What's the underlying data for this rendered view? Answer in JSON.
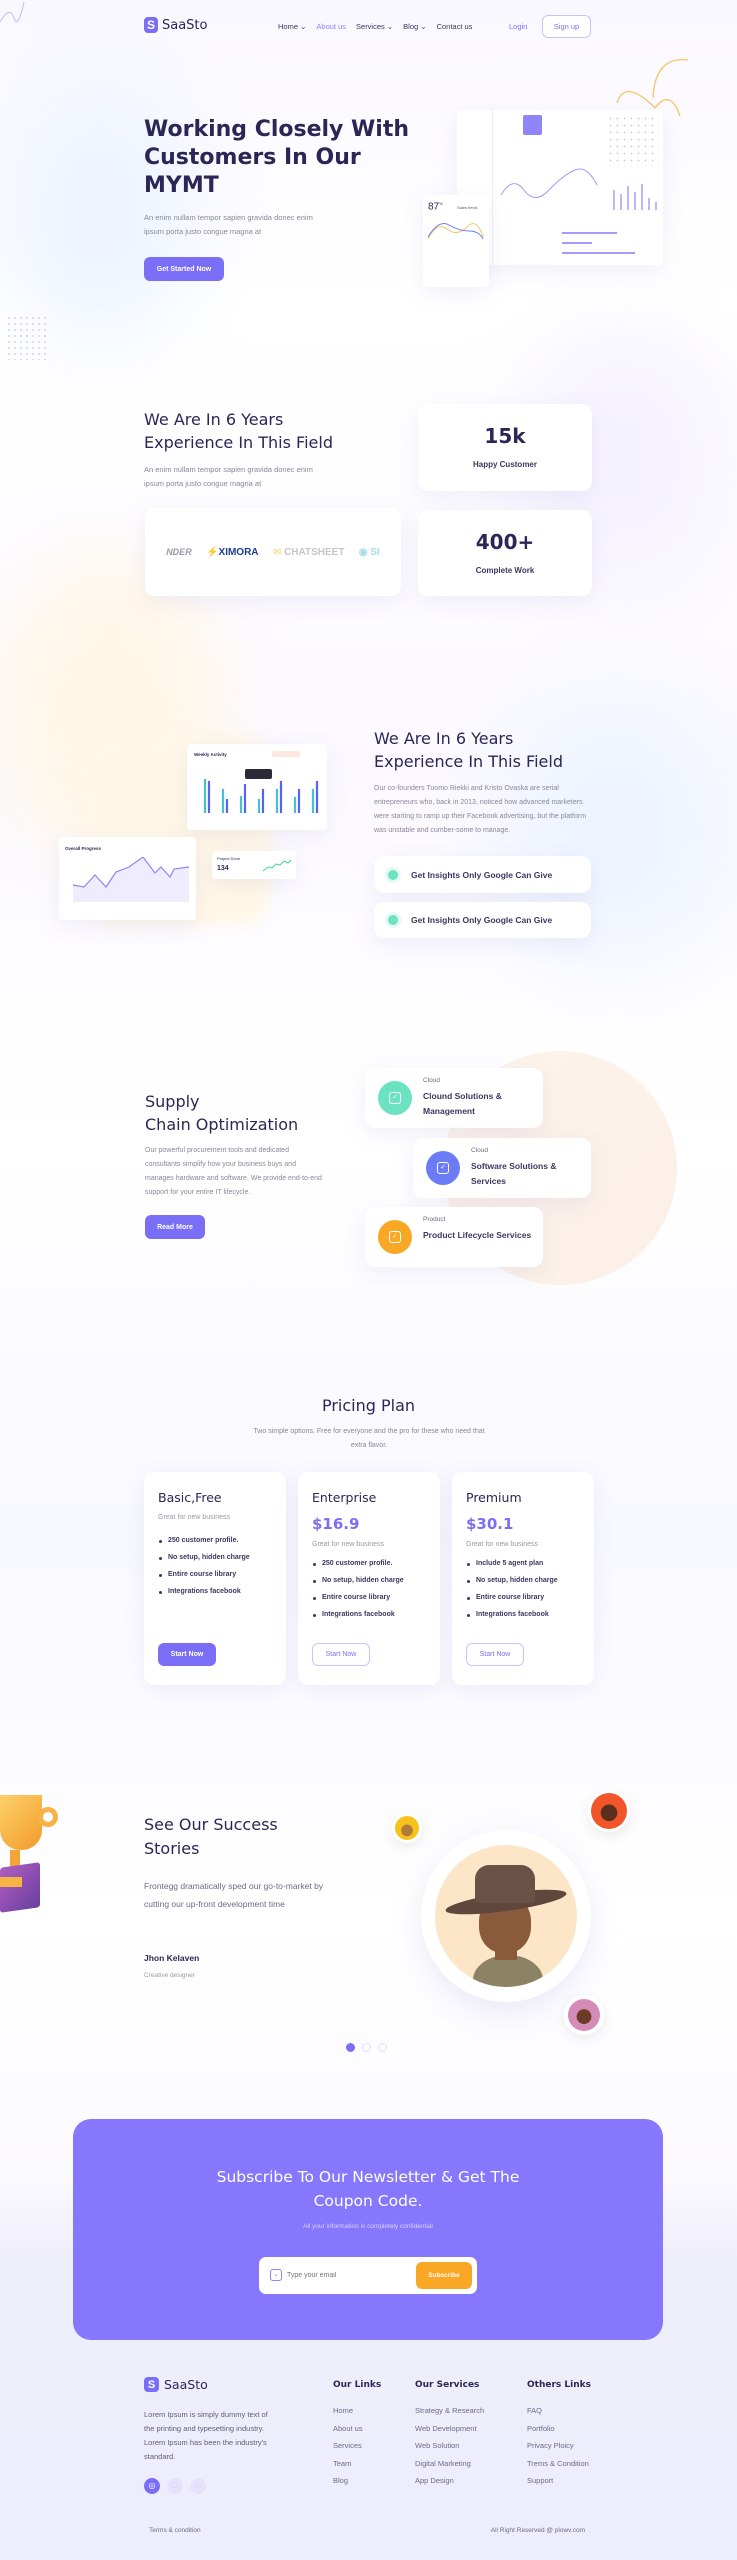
{
  "colors": {
    "primary": "#7b6ef6",
    "dark": "#2b2655",
    "accent": "#f9a826",
    "green": "#6ce3c0",
    "newsletter_bg": "#8677fd"
  },
  "nav": {
    "logo": "SaaSto",
    "items": [
      {
        "label": "Home",
        "dropdown": true
      },
      {
        "label": "About us",
        "active": true
      },
      {
        "label": "Services",
        "dropdown": true
      },
      {
        "label": "Blog",
        "dropdown": true
      },
      {
        "label": "Contact us"
      }
    ],
    "login": "Login",
    "signup": "Sign up"
  },
  "hero": {
    "title": "Working Closely With Customers In Our MYMT",
    "text": "An enim nullam tempor sapien gravida donec enim ipsum porta justo  congue magna at",
    "cta": "Get Started Now",
    "mock": {
      "percent": "87",
      "percent_unit": "%",
      "trend_label": "Sales trend"
    }
  },
  "experience": {
    "title": "We Are In 6 Years Experience In This Field",
    "text": "An enim nullam tempor sapien gravida donec enim ipsum porta justo  congue magna at",
    "logos": [
      "NDER",
      "XIMORA",
      "CHATSHEET",
      "SI"
    ],
    "stats": [
      {
        "value": "15k",
        "label": "Happy Customer"
      },
      {
        "value": "400+",
        "label": "Complete Work"
      }
    ]
  },
  "about": {
    "title": "We Are In 6 Years Experience In This Field",
    "text": "Our co-founders Tuomo Riekki and Kristo Ovaska are serial entrepreneurs who, back in 2013, noticed how advanced marketers were starting to ramp up their Facebook advertising, but the platform was unstable and cumber-some to manage.",
    "features": [
      "Get Insights Only Google Can Give",
      "Get Insights Only Google Can Give"
    ],
    "mock": {
      "weekly": "Weekly Activity",
      "overall": "Overall Progress",
      "project": "Project Done",
      "project_value": "134"
    }
  },
  "supply": {
    "title_line1": "Supply",
    "title_line2": "Chain Optimization",
    "text": "Our powerful procurement tools and dedicated consultants simplify how your business buys and manages hardware and software. We provide end-to-end support for your entire IT lifecycle.",
    "cta": "Read More",
    "services": [
      {
        "tag": "Cloud",
        "title": "Clound Solutions & Management",
        "color": "#6ce3c0"
      },
      {
        "tag": "Cloud",
        "title": "Software Solutions & Services",
        "color": "#6b7cf6"
      },
      {
        "tag": "Product",
        "title": "Product Lifecycle Services",
        "color": "#f9a826"
      }
    ]
  },
  "pricing": {
    "title": "Pricing Plan",
    "subtitle": "Two simple options. Free for everyone and the pro  for these who need that extra flavor.",
    "plans": [
      {
        "name": "Basic,Free",
        "price": "",
        "desc": "Great for new business",
        "features": [
          "250 customer profile.",
          "No setup, hidden charge",
          "Entire course library",
          "Integrations facebook"
        ],
        "cta": "Start Now",
        "primary": true
      },
      {
        "name": "Enterprise",
        "price": "$16.9",
        "desc": "Great for new business",
        "features": [
          "250 customer profile.",
          "No setup, hidden charge",
          "Entire course library",
          "Integrations facebook"
        ],
        "cta": "Start Now",
        "primary": false
      },
      {
        "name": "Premium",
        "price": "$30.1",
        "desc": "Great for new business",
        "features": [
          "Include 5 agent  plan",
          "No setup, hidden charge",
          "Entire course library",
          "Integrations facebook"
        ],
        "cta": "Start Now",
        "primary": false
      }
    ]
  },
  "stories": {
    "title": "See Our Success Stories",
    "quote": "Frontegg dramatically sped our go-to-market by cutting our up-front development time",
    "name": "Jhon Kelaven",
    "role": "Creative designer",
    "active_slide": 1,
    "slides": 3
  },
  "newsletter": {
    "title": "Subscribe To Our Newsletter & Get The Coupon Code.",
    "subtitle": "All your information is completely confidential",
    "placeholder": "Type your email",
    "button": "Subscribe"
  },
  "footer": {
    "logo": "SaaSto",
    "text": "Lorem Ipsum is simply dummy text of the printing and typesetting industry. Lorem Ipsum has been the industry's standard.",
    "social": [
      "instagram-icon",
      "linkedin-icon",
      "youtube-icon"
    ],
    "columns": [
      {
        "title": "Our Links",
        "links": [
          "Home",
          "About us",
          "Services",
          "Team",
          "Blog"
        ]
      },
      {
        "title": "Our Services",
        "links": [
          "Strategy & Research",
          "Web Development",
          "Web Solution",
          "Digital Marketing",
          "App Design"
        ]
      },
      {
        "title": "Others Links",
        "links": [
          "FAQ",
          "Portfolio",
          "Privacy Ploicy",
          "Trems & Condition",
          "Support"
        ]
      }
    ],
    "terms": "Terms & condition",
    "copyright": "All Right Reserved @ plowv.com"
  }
}
